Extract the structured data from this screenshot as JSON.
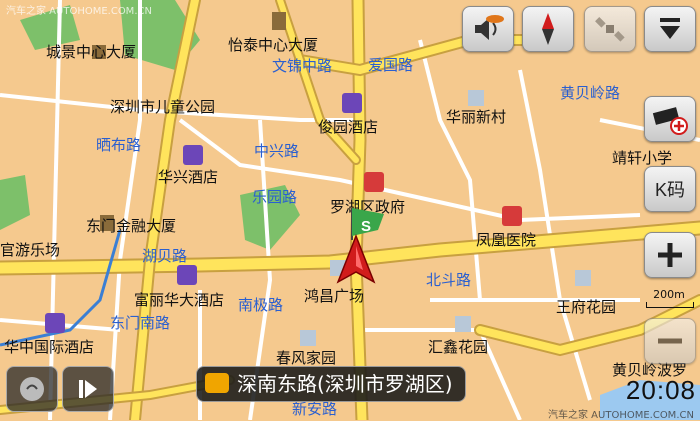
{
  "map": {
    "pois": [
      {
        "label": "城景中心大厦"
      },
      {
        "label": "怡泰中心大厦"
      },
      {
        "label": "深圳市儿童公园"
      },
      {
        "label": "俊园酒店"
      },
      {
        "label": "华丽新村"
      },
      {
        "label": "华兴酒店"
      },
      {
        "label": "罗湖区政府"
      },
      {
        "label": "东门金融大厦"
      },
      {
        "label": "凤凰医院"
      },
      {
        "label": "官游乐场"
      },
      {
        "label": "鸿昌广场"
      },
      {
        "label": "富丽华大酒店"
      },
      {
        "label": "王府花园"
      },
      {
        "label": "华中国际酒店"
      },
      {
        "label": "汇鑫花园"
      },
      {
        "label": "春风家园"
      },
      {
        "label": "靖轩小学"
      }
    ],
    "roads": [
      {
        "label": "文锦中路"
      },
      {
        "label": "爱国路"
      },
      {
        "label": "黄贝岭路"
      },
      {
        "label": "晒布路"
      },
      {
        "label": "中兴路"
      },
      {
        "label": "乐园路"
      },
      {
        "label": "湖贝路"
      },
      {
        "label": "北斗路"
      },
      {
        "label": "南极路"
      },
      {
        "label": "东门南路"
      },
      {
        "label": "新安路"
      },
      {
        "label": "黄贝岭波罗"
      }
    ],
    "current_street": "深南东路(深圳市罗湖区)",
    "scale_label": "200m",
    "clock": "20:08",
    "watermark_left": "汽车之家 AUTOHOME.COM.CN",
    "watermark_right": "汽车之家 AUTOHOME.COM.CN"
  },
  "controls": [
    {
      "name": "volume-button",
      "icon": "speaker-icon"
    },
    {
      "name": "compass-button",
      "icon": "compass-icon"
    },
    {
      "name": "satellite-button",
      "icon": "satellite-icon"
    },
    {
      "name": "menu-down-button",
      "icon": "collapse-down-icon"
    },
    {
      "name": "camera-add-button",
      "icon": "camera-plus-icon"
    },
    {
      "name": "k-code-button",
      "label": "K码"
    },
    {
      "name": "zoom-in-button",
      "icon": "plus-icon"
    },
    {
      "name": "zoom-out-button",
      "icon": "minus-icon"
    }
  ],
  "colors": {
    "land": "#f5c98e",
    "road_major": "#ffe45c",
    "road_minor": "#ffffff",
    "park": "#7dc06a",
    "road_text": "#2a5fd0"
  }
}
